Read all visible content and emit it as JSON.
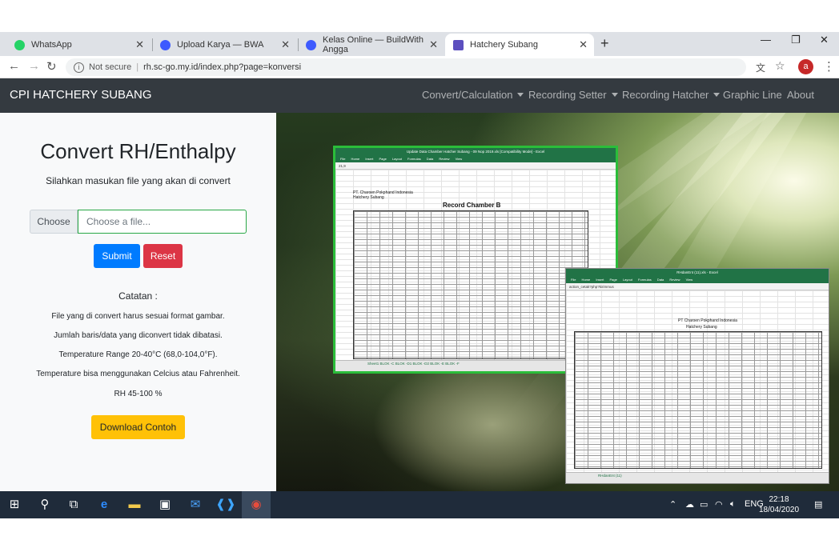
{
  "browser": {
    "tabs": [
      {
        "title": "WhatsApp",
        "color": "#25d366"
      },
      {
        "title": "Upload Karya — BWA",
        "color": "#3d5afe"
      },
      {
        "title": "Kelas Online — BuildWith Angga",
        "color": "#3d5afe"
      },
      {
        "title": "Hatchery Subang",
        "color": "#5c4fbf"
      }
    ],
    "new_tab": "+",
    "security_label": "Not secure",
    "url": "rh.sc-go.my.id/index.php?page=konversi",
    "profile_initial": "a"
  },
  "navbar": {
    "brand": "CPI HATCHERY SUBANG",
    "items": [
      "Convert/Calculation",
      "Recording Setter",
      "Recording Hatcher",
      "Graphic Line",
      "About"
    ]
  },
  "form": {
    "title": "Convert RH/Enthalpy",
    "subtitle": "Silahkan masukan file yang akan di convert",
    "choose_label": "Choose",
    "file_placeholder": "Choose a file...",
    "submit_label": "Submit",
    "reset_label": "Reset",
    "notes_title": "Catatan :",
    "notes": [
      "File yang di convert harus sesuai format gambar.",
      "Jumlah baris/data yang diconvert tidak dibatasi.",
      "Temperature Range 20-40°C (68,0-104,0°F).",
      "Temperature bisa menggunakan Celcius atau Fahrenheit.",
      "RH 45-100 %"
    ],
    "download_label": "Download Contoh"
  },
  "excel1": {
    "title": "Update Data Chamber Hatcher Subang - 09 Nop 2019.xls [Compatibility Mode] - Excel",
    "ribbon": "File Home Insert Page Layout Formulas Data Review View",
    "cell": "21,9",
    "company": "PT. Charoen Pokphand Indonesia",
    "site": "Hatchery Subang",
    "heading": "Record Chamber B",
    "sheets": "Sheet1   BLOK -C   BLOK -D1   BLOK -D2   BLOK -E   BLOK -F"
  },
  "excel2": {
    "title": "RHdanEnt (11).xls - Excel",
    "ribbon": "File Home Insert Page Layout Formulas Data Review View",
    "cell": "action_cetak?php?kirimmus",
    "company": "PT Charoen Pokphand Indonesia",
    "site": "Hatchery Subang",
    "sheet": "RHdanEnt (11)"
  },
  "taskbar": {
    "language": "ENG",
    "time": "22:18",
    "date": "18/04/2020"
  }
}
